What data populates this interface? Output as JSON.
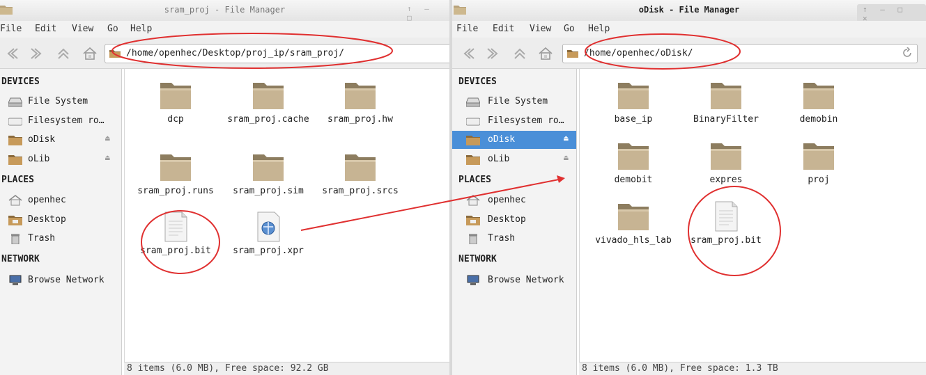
{
  "left_window": {
    "title": "sram_proj - File Manager",
    "menu": [
      "File",
      "Edit",
      "View",
      "Go",
      "Help"
    ],
    "path": "/home/openhec/Desktop/proj_ip/sram_proj/",
    "sidebar": {
      "devices_header": "DEVICES",
      "devices": [
        "File System",
        "Filesystem ro…",
        "oDisk",
        "oLib"
      ],
      "places_header": "PLACES",
      "places": [
        "openhec",
        "Desktop",
        "Trash"
      ],
      "network_header": "NETWORK",
      "network": [
        "Browse Network"
      ]
    },
    "files": [
      {
        "name": "dcp",
        "type": "folder"
      },
      {
        "name": "sram_proj.cache",
        "type": "folder"
      },
      {
        "name": "sram_proj.hw",
        "type": "folder"
      },
      {
        "name": "sram_proj.runs",
        "type": "folder"
      },
      {
        "name": "sram_proj.sim",
        "type": "folder"
      },
      {
        "name": "sram_proj.srcs",
        "type": "folder"
      },
      {
        "name": "sram_proj.bit",
        "type": "file"
      },
      {
        "name": "sram_proj.xpr",
        "type": "xpr"
      }
    ],
    "status": "8 items (6.0 MB), Free space: 92.2 GB"
  },
  "right_window": {
    "title": "oDisk - File Manager",
    "menu": [
      "File",
      "Edit",
      "View",
      "Go",
      "Help"
    ],
    "path": "/home/openhec/oDisk/",
    "sidebar": {
      "devices_header": "DEVICES",
      "devices": [
        "File System",
        "Filesystem ro…",
        "oDisk",
        "oLib"
      ],
      "selected_device": "oDisk",
      "places_header": "PLACES",
      "places": [
        "openhec",
        "Desktop",
        "Trash"
      ],
      "network_header": "NETWORK",
      "network": [
        "Browse Network"
      ]
    },
    "files": [
      {
        "name": "base_ip",
        "type": "folder"
      },
      {
        "name": "BinaryFilter",
        "type": "folder"
      },
      {
        "name": "demobin",
        "type": "folder"
      },
      {
        "name": "demobit",
        "type": "folder"
      },
      {
        "name": "expres",
        "type": "folder"
      },
      {
        "name": "proj",
        "type": "folder"
      },
      {
        "name": "vivado_hls_lab",
        "type": "folder"
      },
      {
        "name": "sram_proj.bit",
        "type": "file"
      }
    ],
    "status": "8 items (6.0 MB), Free space: 1.3 TB"
  },
  "colors": {
    "selection": "#4a8fd8",
    "annotation": "#e03030",
    "folder": "#b8a27a"
  },
  "icons": {
    "back": "back-arrow-icon",
    "forward": "forward-arrow-icon",
    "up": "up-arrow-icon",
    "home": "home-icon",
    "reload": "reload-icon"
  }
}
